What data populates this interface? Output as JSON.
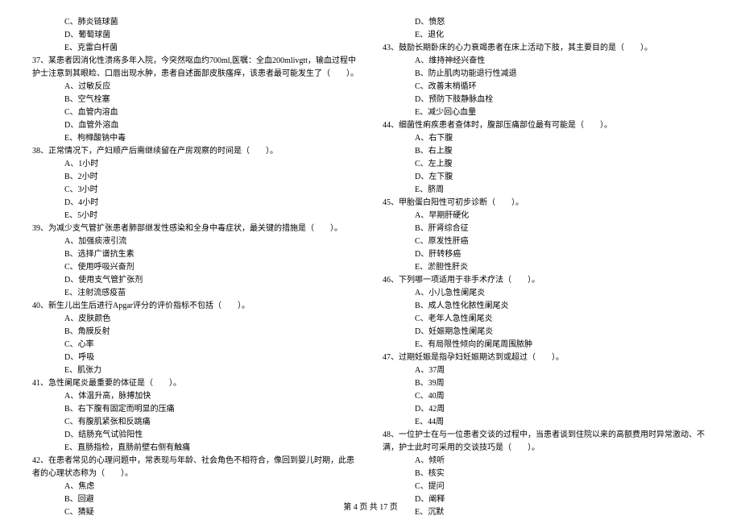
{
  "leftColumn": {
    "q36_options": [
      "C、肺炎链球菌",
      "D、葡萄球菌",
      "E、克雷白杆菌"
    ],
    "q37": "37、某患者因消化性溃疡多年入院，今突然呕血约700ml,医嘱：全血200mlivgtt，输血过程中护士注意到其眼睑、口唇出现水肿，患者自述面部皮肤瘙痒，该患者最可能发生了（　　）。",
    "q37_options": [
      "A、过敏反应",
      "B、空气栓塞",
      "C、血管内溶血",
      "D、血管外溶血",
      "E、枸橼酸钠中毒"
    ],
    "q38": "38、正常情况下，产妇顺产后需继续留在产房观察的时间是（　　）。",
    "q38_options": [
      "A、1小时",
      "B、2小时",
      "C、3小时",
      "D、4小时",
      "E、5小时"
    ],
    "q39": "39、为减少支气管扩张患者肺部继发性感染和全身中毒症状，最关键的措施是（　　）。",
    "q39_options": [
      "A、加强痰液引流",
      "B、选择广谱抗生素",
      "C、使用呼吸兴奋剂",
      "D、使用支气管扩张剂",
      "E、注射流感疫苗"
    ],
    "q40": "40、新生儿出生后进行Apgar评分的评价指标不包括（　　）。",
    "q40_options": [
      "A、皮肤颜色",
      "B、角膜反射",
      "C、心率",
      "D、呼吸",
      "E、肌张力"
    ],
    "q41": "41、急性阑尾炎最重要的体征是（　　）。",
    "q41_options": [
      "A、体温升高，脉搏加快",
      "B、右下腹有固定而明显的压痛",
      "C、有腹肌紧张和反跳痛",
      "D、结肠充气试验阳性",
      "E、直肠指检，直肠前壁右侧有触痛"
    ],
    "q42": "42、在患者常见的心理问题中，常表现与年龄、社会角色不相符合，像回到婴儿时期，此患者的心理状态称为（　　）。",
    "q42_options": [
      "A、焦虑",
      "B、回避",
      "C、猜疑"
    ]
  },
  "rightColumn": {
    "q42_options_cont": [
      "D、愤怒",
      "E、退化"
    ],
    "q43": "43、鼓励长期卧床的心力衰竭患者在床上活动下肢，其主要目的是（　　）。",
    "q43_options": [
      "A、维持神经兴奋性",
      "B、防止肌肉功能退行性减退",
      "C、改善末梢循环",
      "D、预防下肢静脉血栓",
      "E、减少回心血量"
    ],
    "q44": "44、细菌性痢疾患者查体时，腹部压痛部位最有可能是（　　）。",
    "q44_options": [
      "A、右下腹",
      "B、右上腹",
      "C、左上腹",
      "D、左下腹",
      "E、脐周"
    ],
    "q45": "45、甲胎蛋白阳性可初步诊断（　　）。",
    "q45_options": [
      "A、早期肝硬化",
      "B、肝肾综合征",
      "C、原发性肝癌",
      "D、肝转移癌",
      "E、淤胆性肝炎"
    ],
    "q46": "46、下列哪一项适用于非手术疗法（　　）。",
    "q46_options": [
      "A、小儿急性阑尾炎",
      "B、成人急性化脓性阑尾炎",
      "C、老年人急性阑尾炎",
      "D、妊娠期急性阑尾炎",
      "E、有局限性倾向的阑尾周围脓肿"
    ],
    "q47": "47、过期妊娠是指孕妇妊娠期达到或超过（　　）。",
    "q47_options": [
      "A、37周",
      "B、39周",
      "C、40周",
      "D、42周",
      "E、44周"
    ],
    "q48": "48、一位护士在与一位患者交谈的过程中，当患者谈到住院以来的高额费用时异常激动、不满，护士此时可采用的交谈技巧是（　　）。",
    "q48_options": [
      "A、倾听",
      "B、核实",
      "C、提问",
      "D、阐释",
      "E、沉默"
    ]
  },
  "footer": "第 4 页 共 17 页"
}
